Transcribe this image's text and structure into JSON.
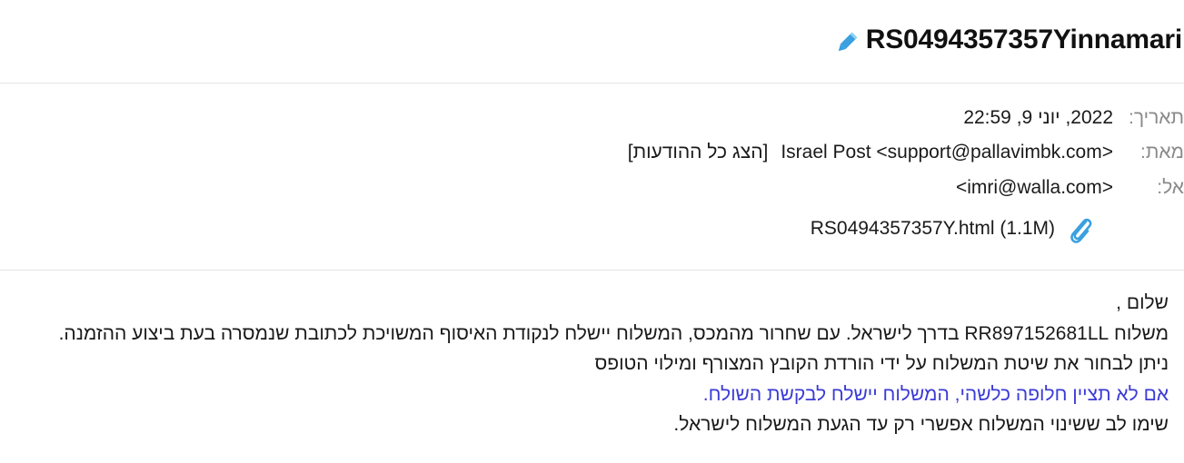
{
  "subject": {
    "text": "RS0494357357Yinnamari"
  },
  "meta": {
    "date_label": "תאריך:",
    "date_value": "2022, יוני 9, 22:59",
    "from_label": "מאת:",
    "from_value": "Israel Post <support@pallavimbk.com>",
    "show_all_label": "[הצג כל ההודעות]",
    "to_label": "אל:",
    "to_value": "<imri@walla.com>",
    "attachment": "RS0494357357Y.html (1.1M)"
  },
  "body": {
    "greeting": "שלום ,",
    "line1": "משלוח RR897152681LL בדרך לישראל. עם שחרור מהמכס, המשלוח יישלח לנקודת האיסוף המשויכת לכתובת שנמסרה בעת ביצוע ההזמנה.",
    "line2": "ניתן לבחור את שיטת המשלוח על ידי הורדת הקובץ המצורף ומילוי הטופס",
    "link_line": "אם לא תציין חלופה כלשהי, המשלוח יישלח לבקשת השולח.",
    "line4": "שימו לב ששינוי המשלוח אפשרי רק עד הגעת המשלוח לישראל."
  },
  "colors": {
    "link": "#3b3bd6",
    "label": "#8a8a8a",
    "edit_icon": "#3aa0e0",
    "clip_icon": "#3aa0e0"
  },
  "icons": {
    "edit": "pencil-icon",
    "attachment": "paperclip-icon"
  }
}
